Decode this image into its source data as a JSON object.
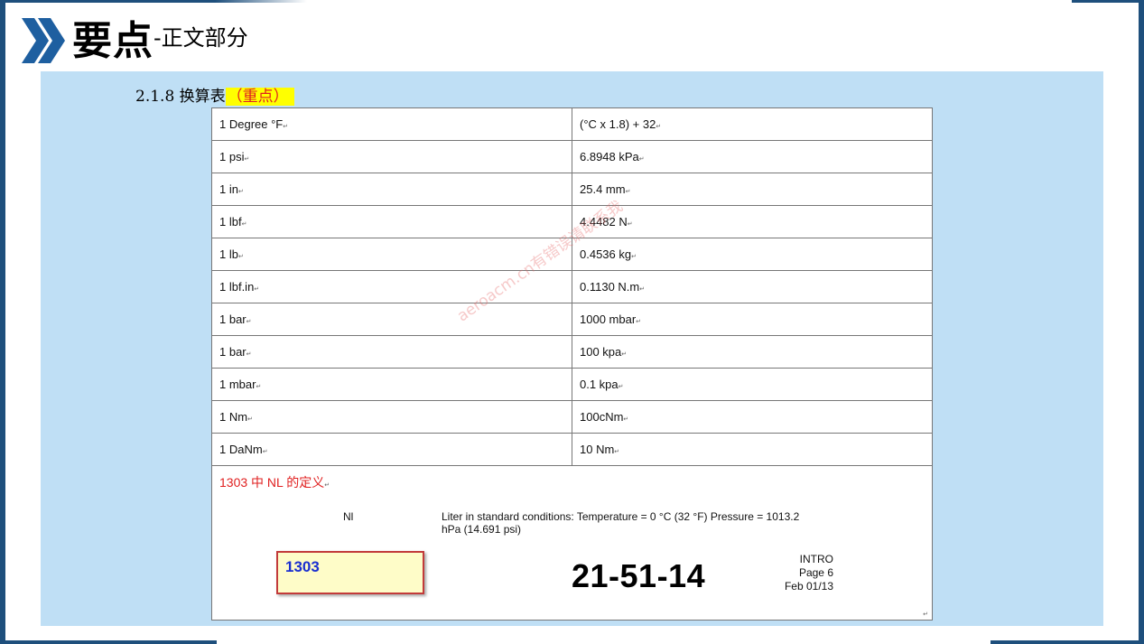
{
  "header": {
    "title_main": "要点",
    "title_sub": "-正文部分"
  },
  "section": {
    "heading": "2.1.8 换算表",
    "highlight": "（重点）"
  },
  "conversion_table": {
    "rows": [
      {
        "unit": "1 Degree °F",
        "value": "(°C x 1.8) + 32"
      },
      {
        "unit": "1 psi",
        "value": "6.8948 kPa"
      },
      {
        "unit": "1 in",
        "value": "25.4 mm"
      },
      {
        "unit": "1 lbf",
        "value": "4.4482 N"
      },
      {
        "unit": "1 lb",
        "value": "0.4536 kg"
      },
      {
        "unit": "1 lbf.in",
        "value": "0.1130 N.m"
      },
      {
        "unit": "1 bar",
        "value": "1000 mbar"
      },
      {
        "unit": "1 bar",
        "value": "100 kpa"
      },
      {
        "unit": "1 mbar",
        "value": "0.1 kpa"
      },
      {
        "unit": "1 Nm",
        "value": "100cNm"
      },
      {
        "unit": "1 DaNm",
        "value": "10 Nm"
      }
    ]
  },
  "note": {
    "text": "1303 中 NL 的定义"
  },
  "excerpt": {
    "term": "Nl",
    "definition": "Liter in standard conditions: Temperature = 0 °C (32 °F) Pressure = 1013.2 hPa (14.691 psi)",
    "highlight_box": "1303",
    "chapter": "21-51-14",
    "section_label": "INTRO",
    "page": "Page 6",
    "date": "Feb 01/13"
  },
  "watermark": "aeroacm.cn有错误请联系我",
  "colors": {
    "frame": "#1e4f7c",
    "panel": "#bfdff5",
    "highlight_bg": "#ffff00",
    "highlight_text": "#e02020",
    "note_text": "#e02020",
    "box_text": "#1a2fd0"
  }
}
